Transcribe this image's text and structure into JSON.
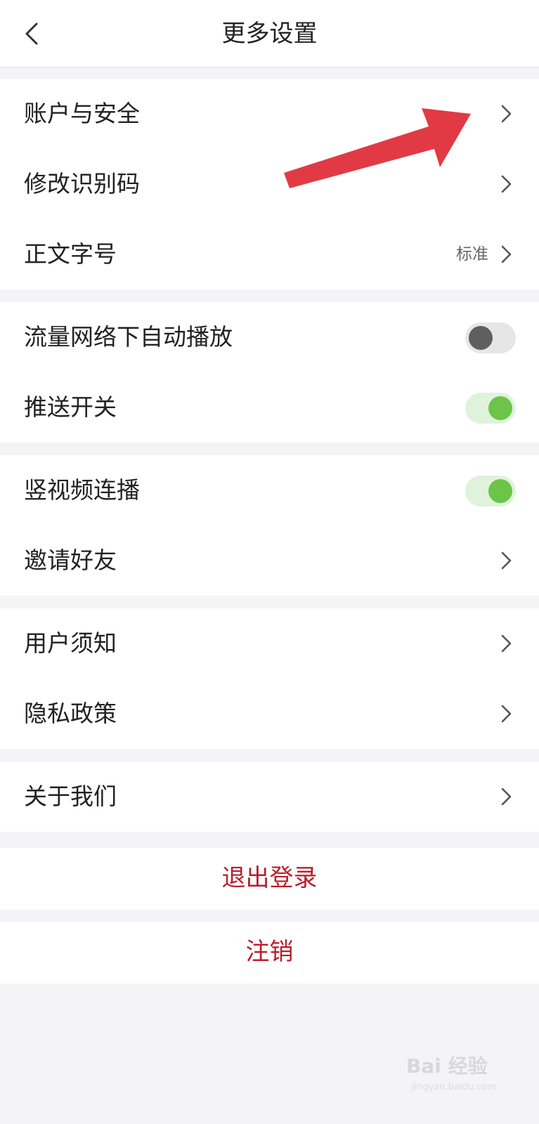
{
  "header": {
    "title": "更多设置",
    "back_icon": "chevron-left-icon"
  },
  "groups": [
    {
      "items": [
        {
          "label": "账户与安全",
          "type": "link"
        },
        {
          "label": "修改识别码",
          "type": "link"
        },
        {
          "label": "正文字号",
          "type": "link",
          "value": "标准"
        }
      ]
    },
    {
      "items": [
        {
          "label": "流量网络下自动播放",
          "type": "toggle",
          "on": false
        },
        {
          "label": "推送开关",
          "type": "toggle",
          "on": true
        }
      ]
    },
    {
      "items": [
        {
          "label": "竖视频连播",
          "type": "toggle",
          "on": true
        },
        {
          "label": "邀请好友",
          "type": "link"
        }
      ]
    },
    {
      "items": [
        {
          "label": "用户须知",
          "type": "link"
        },
        {
          "label": "隐私政策",
          "type": "link"
        }
      ]
    },
    {
      "items": [
        {
          "label": "关于我们",
          "type": "link"
        }
      ]
    }
  ],
  "actions": {
    "logout": "退出登录",
    "deregister": "注销"
  },
  "colors": {
    "accent_red": "#b81e2d",
    "toggle_on_knob": "#6cc448",
    "toggle_on_track": "#dff3da",
    "toggle_off_knob": "#5f5f5f",
    "toggle_off_track": "#e6e6e6",
    "annotation_arrow": "#e23a45",
    "background": "#f4f4f6"
  },
  "annotation": {
    "icon": "red-arrow-icon"
  },
  "watermark": {
    "text": "Bai 经验",
    "sub": "jingyan.baidu.com"
  }
}
